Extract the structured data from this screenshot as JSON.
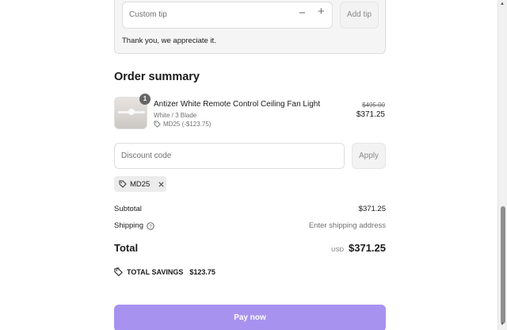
{
  "tip": {
    "placeholder": "Custom tip",
    "minus": "−",
    "plus": "+",
    "add_label": "Add tip",
    "thanks": "Thank you, we appreciate it."
  },
  "summary": {
    "title": "Order summary",
    "item": {
      "quantity": "1",
      "name": "Antizer White Remote Control Ceiling Fan Light",
      "variant": "White / 3 Blade",
      "discount": "MD25 (-$123.75)",
      "original_price": "$495.00",
      "price": "$371.25"
    },
    "discount_field": {
      "placeholder": "Discount code",
      "apply_label": "Apply"
    },
    "applied_code": "MD25",
    "subtotal": {
      "label": "Subtotal",
      "value": "$371.25"
    },
    "shipping": {
      "label": "Shipping",
      "value": "Enter shipping address"
    },
    "total": {
      "label": "Total",
      "currency": "USD",
      "value": "$371.25"
    },
    "savings": {
      "label": "TOTAL SAVINGS",
      "value": "$123.75"
    }
  },
  "pay_button": {
    "label": "Pay now",
    "color": "#a892f0"
  },
  "icons": [
    "tag-icon",
    "help-icon",
    "close-icon",
    "minus-icon",
    "plus-icon"
  ]
}
